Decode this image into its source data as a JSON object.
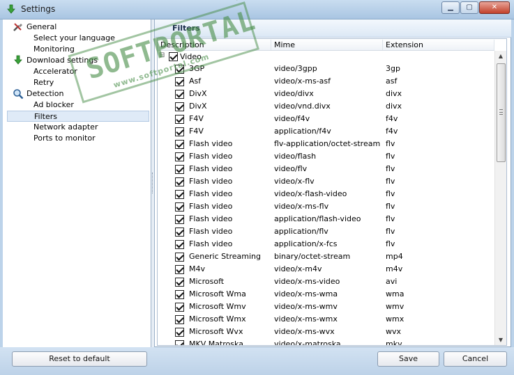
{
  "window": {
    "title": "Settings",
    "minimize_glyph": "▁",
    "maximize_glyph": "▢",
    "close_glyph": "✕"
  },
  "tree": {
    "items": [
      {
        "label": "General",
        "icon": "tools-icon",
        "level": 0
      },
      {
        "label": "Select your language",
        "level": 1
      },
      {
        "label": "Monitoring",
        "level": 1
      },
      {
        "label": "Download settings",
        "icon": "download-arrow-icon",
        "level": 0
      },
      {
        "label": "Accelerator",
        "level": 1
      },
      {
        "label": "Retry",
        "level": 1
      },
      {
        "label": "Detection",
        "icon": "magnifier-icon",
        "level": 0
      },
      {
        "label": "Ad blocker",
        "level": 1
      },
      {
        "label": "Filters",
        "level": 1,
        "selected": true
      },
      {
        "label": "Network adapter",
        "level": 1
      },
      {
        "label": "Ports to monitor",
        "level": 1
      }
    ]
  },
  "panel": {
    "title": "Filters",
    "columns": [
      "Description",
      "Mime",
      "Extension"
    ],
    "group": {
      "label": "Video",
      "toggle": "⊟"
    },
    "rows": [
      {
        "desc": "3GP",
        "mime": "video/3gpp",
        "ext": "3gp"
      },
      {
        "desc": "Asf",
        "mime": "video/x-ms-asf",
        "ext": "asf"
      },
      {
        "desc": "DivX",
        "mime": "video/divx",
        "ext": "divx"
      },
      {
        "desc": "DivX",
        "mime": "video/vnd.divx",
        "ext": "divx"
      },
      {
        "desc": "F4V",
        "mime": "video/f4v",
        "ext": "f4v"
      },
      {
        "desc": "F4V",
        "mime": "application/f4v",
        "ext": "f4v"
      },
      {
        "desc": "Flash video",
        "mime": "flv-application/octet-stream",
        "ext": "flv"
      },
      {
        "desc": "Flash video",
        "mime": "video/flash",
        "ext": "flv"
      },
      {
        "desc": "Flash video",
        "mime": "video/flv",
        "ext": "flv"
      },
      {
        "desc": "Flash video",
        "mime": "video/x-flv",
        "ext": "flv"
      },
      {
        "desc": "Flash video",
        "mime": "video/x-flash-video",
        "ext": "flv"
      },
      {
        "desc": "Flash video",
        "mime": "video/x-ms-flv",
        "ext": "flv"
      },
      {
        "desc": "Flash video",
        "mime": "application/flash-video",
        "ext": "flv"
      },
      {
        "desc": "Flash video",
        "mime": "application/flv",
        "ext": "flv"
      },
      {
        "desc": "Flash video",
        "mime": "application/x-fcs",
        "ext": "flv"
      },
      {
        "desc": "Generic Streaming",
        "mime": "binary/octet-stream",
        "ext": "mp4"
      },
      {
        "desc": "M4v",
        "mime": "video/x-m4v",
        "ext": "m4v"
      },
      {
        "desc": "Microsoft",
        "mime": "video/x-ms-video",
        "ext": "avi"
      },
      {
        "desc": "Microsoft Wma",
        "mime": "video/x-ms-wma",
        "ext": "wma"
      },
      {
        "desc": "Microsoft Wmv",
        "mime": "video/x-ms-wmv",
        "ext": "wmv"
      },
      {
        "desc": "Microsoft Wmx",
        "mime": "video/x-ms-wmx",
        "ext": "wmx"
      },
      {
        "desc": "Microsoft Wvx",
        "mime": "video/x-ms-wvx",
        "ext": "wvx"
      },
      {
        "desc": "MKV Matroska",
        "mime": "video/x-matroska",
        "ext": "mkv"
      }
    ]
  },
  "buttons": {
    "reset": "Reset to default",
    "save": "Save",
    "cancel": "Cancel"
  },
  "watermark": {
    "main": "SOFTPORTAL",
    "sub": "www.softportal.com",
    "tm": "TM"
  }
}
